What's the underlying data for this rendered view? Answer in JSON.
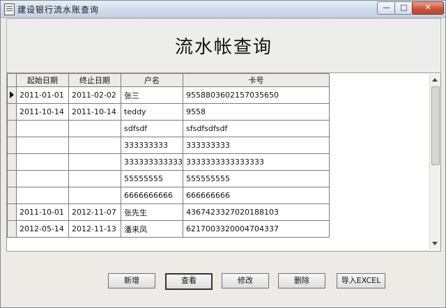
{
  "window": {
    "title": "建设银行流水账查询",
    "min_glyph": "—",
    "max_glyph": "□",
    "close_glyph": "✕"
  },
  "header": {
    "title": "流水帐查询"
  },
  "grid": {
    "columns": [
      "起始日期",
      "终止日期",
      "户名",
      "卡号"
    ],
    "rows": [
      [
        "2011-01-01",
        "2011-02-02",
        "张三",
        "9558803602157035650"
      ],
      [
        "2011-10-14",
        "2011-10-14",
        "teddy",
        "9558"
      ],
      [
        "",
        "",
        "sdfsdf",
        "sfsdfsdfsdf"
      ],
      [
        "",
        "",
        "333333333",
        "333333333"
      ],
      [
        "",
        "",
        "333333333333",
        "3333333333333333"
      ],
      [
        "",
        "",
        "55555555",
        "555555555"
      ],
      [
        "",
        "",
        "6666666666",
        "666666666"
      ],
      [
        "2011-10-01",
        "2012-11-07",
        "张先生",
        "4367423327020188103"
      ],
      [
        "2012-05-14",
        "2012-11-13",
        "潘来凤",
        "6217003320004704337"
      ]
    ],
    "selected_row": 0
  },
  "buttons": {
    "add": "新增",
    "view": "查看",
    "edit": "修改",
    "delete": "删除",
    "import": "导入EXCEL"
  }
}
